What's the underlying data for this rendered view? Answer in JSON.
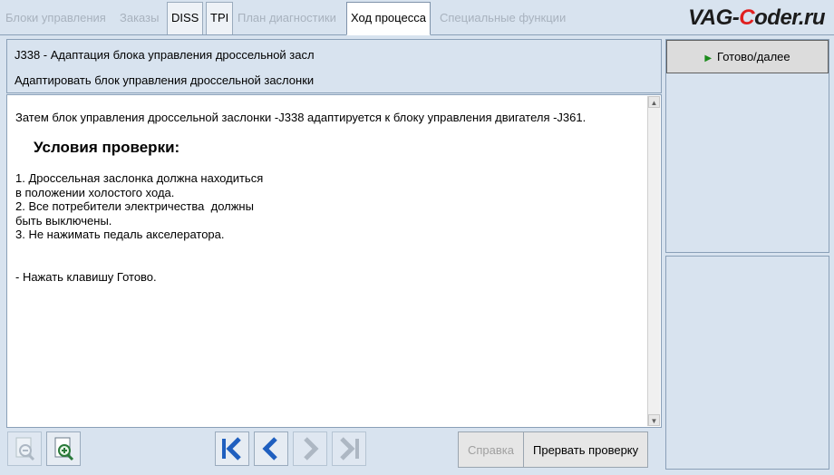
{
  "tabs": [
    {
      "label": "Блоки управления",
      "state": "disabled"
    },
    {
      "label": "Заказы",
      "state": "disabled"
    },
    {
      "label": "DISS",
      "state": "enabled"
    },
    {
      "label": "TPI",
      "state": "enabled"
    },
    {
      "label": "План диагностики",
      "state": "disabled"
    },
    {
      "label": "Ход процесса",
      "state": "active"
    },
    {
      "label": "Специальные функции",
      "state": "disabled"
    }
  ],
  "watermark": {
    "pre": "VAG-",
    "accent": "C",
    "post": "oder.ru"
  },
  "header": {
    "line1": "J338 - Адаптация блока управления дроссельной засл",
    "line2": "Адаптировать блок управления дроссельной заслонки"
  },
  "content": {
    "intro": "Затем блок управления дроссельной заслонки -J338 адаптируется к блоку управления двигателя -J361.",
    "heading": "Условия проверки:",
    "conditions": [
      "1. Дроссельная заслонка должна находиться",
      "в положении холостого хода.",
      "2. Все потребители электричества  должны",
      "быть выключены.",
      "3. Не нажимать педаль акселератора."
    ],
    "instruction": "- Нажать клавишу Готово."
  },
  "sidebar": {
    "done_label": "Готово/далее"
  },
  "toolbar": {
    "help_label": "Справка",
    "abort_label": "Прервать проверку"
  },
  "colors": {
    "accent_blue": "#1f5fbf",
    "play_green": "#1a8a1a",
    "watermark_red": "#e02020"
  }
}
